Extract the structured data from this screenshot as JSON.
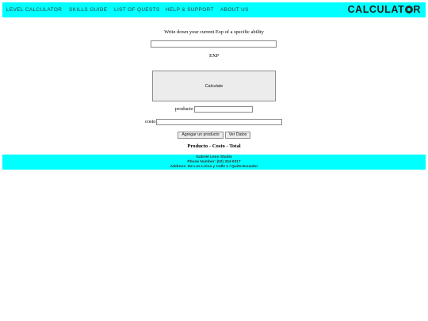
{
  "header": {
    "nav": [
      {
        "label": "LEVEL CALCULATOR"
      },
      {
        "label": "SKILLS GUIDE"
      },
      {
        "label": "LIST OF QUESTS"
      },
      {
        "label": "HELP & SUPPORT"
      },
      {
        "label": "ABOUT US"
      }
    ],
    "logo_text": "CALCULATOR",
    "logo_before_wheel": "CALCULAT",
    "logo_after_wheel": "R"
  },
  "form": {
    "instruction": "Write down your current Exp of a specific ability",
    "exp_value": "",
    "exp_label": "EXP",
    "calculate_label": "Calculate"
  },
  "products": {
    "producto_label": "producto",
    "producto_value": "",
    "costo_label": "costo",
    "costo_value": "",
    "add_button_label": "Agregar un producto",
    "view_button_label": "Ver Datos",
    "table_header": "Producto - Costo - Total"
  },
  "footer": {
    "studio": "Gabriel Leon Studio",
    "phone": "Phone Number: (02) 334-0317",
    "address": "Address: De Los Lirios y Calle 1 / Quito-Ecuador"
  },
  "colors": {
    "banner": "#00ffff"
  }
}
